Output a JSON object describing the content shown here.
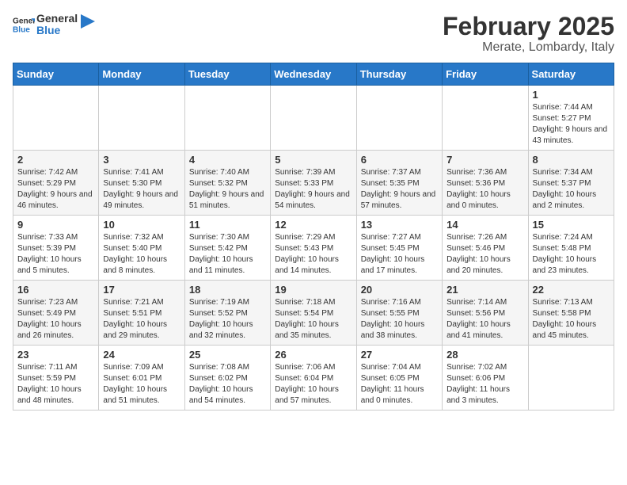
{
  "logo": {
    "text_general": "General",
    "text_blue": "Blue"
  },
  "header": {
    "title": "February 2025",
    "subtitle": "Merate, Lombardy, Italy"
  },
  "days_of_week": [
    "Sunday",
    "Monday",
    "Tuesday",
    "Wednesday",
    "Thursday",
    "Friday",
    "Saturday"
  ],
  "weeks": [
    [
      {
        "day": "",
        "info": ""
      },
      {
        "day": "",
        "info": ""
      },
      {
        "day": "",
        "info": ""
      },
      {
        "day": "",
        "info": ""
      },
      {
        "day": "",
        "info": ""
      },
      {
        "day": "",
        "info": ""
      },
      {
        "day": "1",
        "info": "Sunrise: 7:44 AM\nSunset: 5:27 PM\nDaylight: 9 hours and 43 minutes."
      }
    ],
    [
      {
        "day": "2",
        "info": "Sunrise: 7:42 AM\nSunset: 5:29 PM\nDaylight: 9 hours and 46 minutes."
      },
      {
        "day": "3",
        "info": "Sunrise: 7:41 AM\nSunset: 5:30 PM\nDaylight: 9 hours and 49 minutes."
      },
      {
        "day": "4",
        "info": "Sunrise: 7:40 AM\nSunset: 5:32 PM\nDaylight: 9 hours and 51 minutes."
      },
      {
        "day": "5",
        "info": "Sunrise: 7:39 AM\nSunset: 5:33 PM\nDaylight: 9 hours and 54 minutes."
      },
      {
        "day": "6",
        "info": "Sunrise: 7:37 AM\nSunset: 5:35 PM\nDaylight: 9 hours and 57 minutes."
      },
      {
        "day": "7",
        "info": "Sunrise: 7:36 AM\nSunset: 5:36 PM\nDaylight: 10 hours and 0 minutes."
      },
      {
        "day": "8",
        "info": "Sunrise: 7:34 AM\nSunset: 5:37 PM\nDaylight: 10 hours and 2 minutes."
      }
    ],
    [
      {
        "day": "9",
        "info": "Sunrise: 7:33 AM\nSunset: 5:39 PM\nDaylight: 10 hours and 5 minutes."
      },
      {
        "day": "10",
        "info": "Sunrise: 7:32 AM\nSunset: 5:40 PM\nDaylight: 10 hours and 8 minutes."
      },
      {
        "day": "11",
        "info": "Sunrise: 7:30 AM\nSunset: 5:42 PM\nDaylight: 10 hours and 11 minutes."
      },
      {
        "day": "12",
        "info": "Sunrise: 7:29 AM\nSunset: 5:43 PM\nDaylight: 10 hours and 14 minutes."
      },
      {
        "day": "13",
        "info": "Sunrise: 7:27 AM\nSunset: 5:45 PM\nDaylight: 10 hours and 17 minutes."
      },
      {
        "day": "14",
        "info": "Sunrise: 7:26 AM\nSunset: 5:46 PM\nDaylight: 10 hours and 20 minutes."
      },
      {
        "day": "15",
        "info": "Sunrise: 7:24 AM\nSunset: 5:48 PM\nDaylight: 10 hours and 23 minutes."
      }
    ],
    [
      {
        "day": "16",
        "info": "Sunrise: 7:23 AM\nSunset: 5:49 PM\nDaylight: 10 hours and 26 minutes."
      },
      {
        "day": "17",
        "info": "Sunrise: 7:21 AM\nSunset: 5:51 PM\nDaylight: 10 hours and 29 minutes."
      },
      {
        "day": "18",
        "info": "Sunrise: 7:19 AM\nSunset: 5:52 PM\nDaylight: 10 hours and 32 minutes."
      },
      {
        "day": "19",
        "info": "Sunrise: 7:18 AM\nSunset: 5:54 PM\nDaylight: 10 hours and 35 minutes."
      },
      {
        "day": "20",
        "info": "Sunrise: 7:16 AM\nSunset: 5:55 PM\nDaylight: 10 hours and 38 minutes."
      },
      {
        "day": "21",
        "info": "Sunrise: 7:14 AM\nSunset: 5:56 PM\nDaylight: 10 hours and 41 minutes."
      },
      {
        "day": "22",
        "info": "Sunrise: 7:13 AM\nSunset: 5:58 PM\nDaylight: 10 hours and 45 minutes."
      }
    ],
    [
      {
        "day": "23",
        "info": "Sunrise: 7:11 AM\nSunset: 5:59 PM\nDaylight: 10 hours and 48 minutes."
      },
      {
        "day": "24",
        "info": "Sunrise: 7:09 AM\nSunset: 6:01 PM\nDaylight: 10 hours and 51 minutes."
      },
      {
        "day": "25",
        "info": "Sunrise: 7:08 AM\nSunset: 6:02 PM\nDaylight: 10 hours and 54 minutes."
      },
      {
        "day": "26",
        "info": "Sunrise: 7:06 AM\nSunset: 6:04 PM\nDaylight: 10 hours and 57 minutes."
      },
      {
        "day": "27",
        "info": "Sunrise: 7:04 AM\nSunset: 6:05 PM\nDaylight: 11 hours and 0 minutes."
      },
      {
        "day": "28",
        "info": "Sunrise: 7:02 AM\nSunset: 6:06 PM\nDaylight: 11 hours and 3 minutes."
      },
      {
        "day": "",
        "info": ""
      }
    ]
  ]
}
